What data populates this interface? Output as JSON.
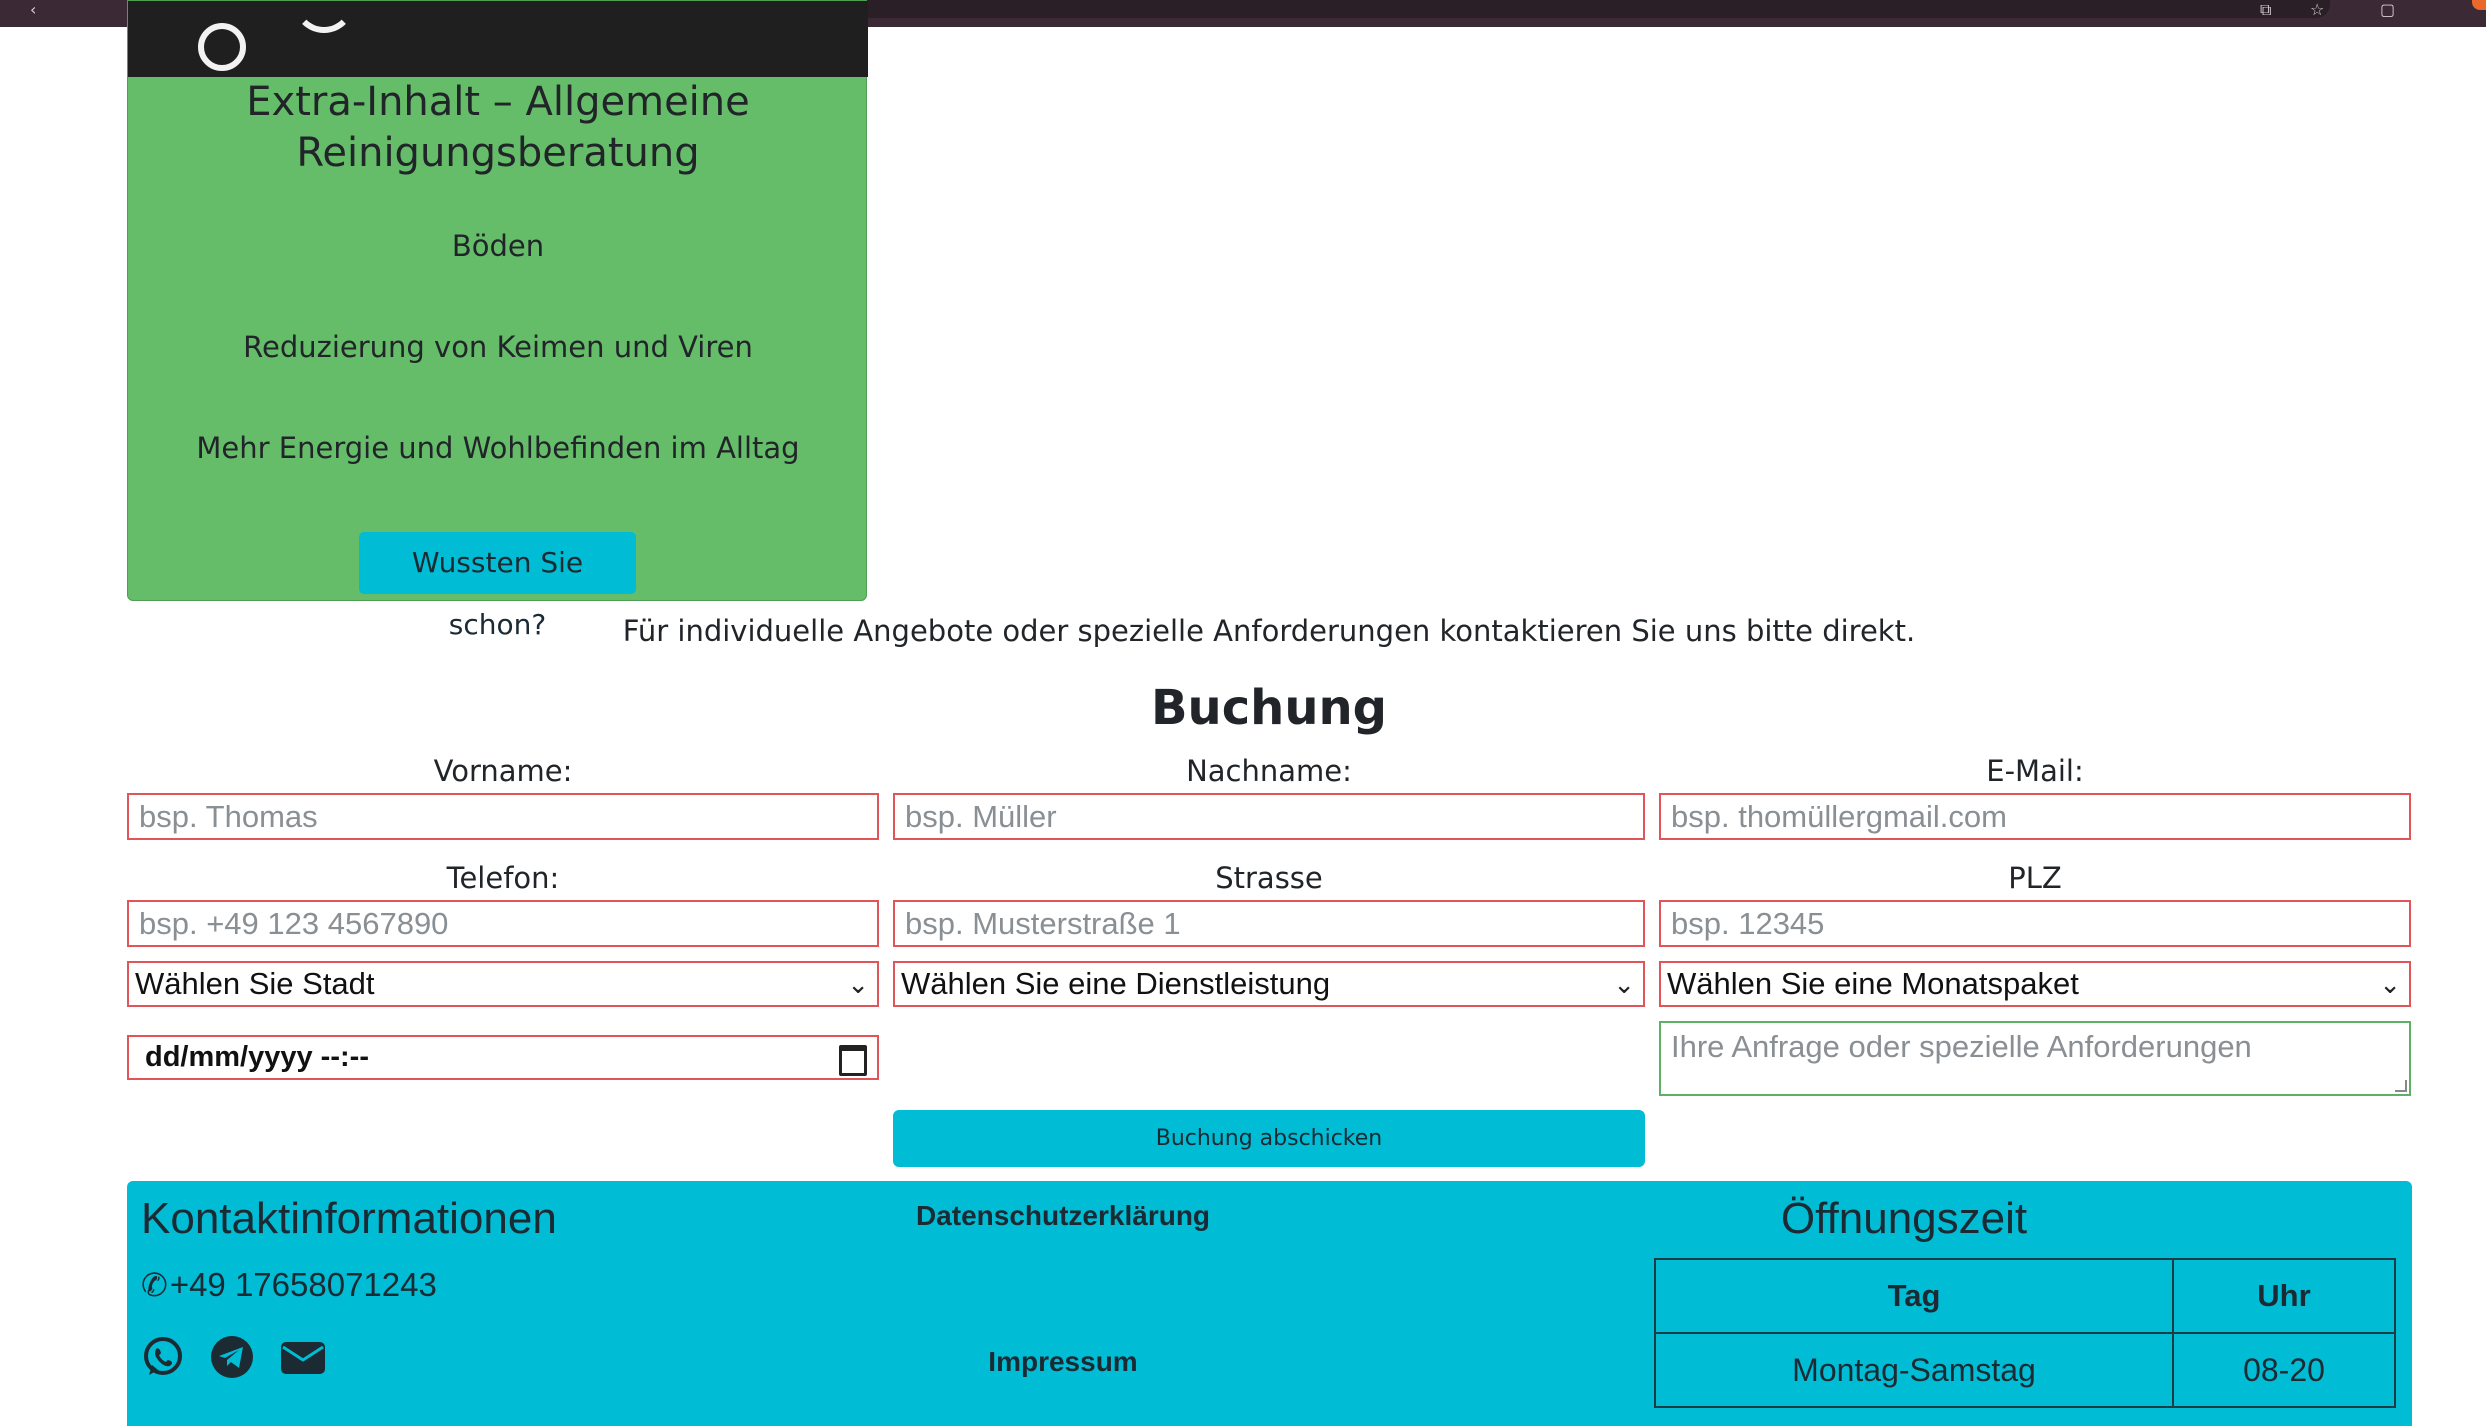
{
  "card": {
    "title_line1": "Extra-Inhalt – Allgemeine",
    "title_line2": "Reinigungsberatung",
    "items": [
      "Böden",
      "Reduzierung von Keimen und Viren",
      "Mehr Energie und Wohlbefinden im Alltag"
    ],
    "button_label": "Wussten Sie schon?",
    "colors": {
      "background": "#66bd69",
      "button": "#00bcd4"
    }
  },
  "contact_note": "Für individuelle Angebote oder spezielle Anforderungen kontaktieren Sie uns bitte direkt.",
  "booking": {
    "title": "Buchung",
    "fields": {
      "vorname": {
        "label": "Vorname:",
        "placeholder": "bsp. Thomas"
      },
      "nachname": {
        "label": "Nachname:",
        "placeholder": "bsp. Müller"
      },
      "email": {
        "label": "E-Mail:",
        "placeholder": "bsp. thomüllergmail.com"
      },
      "telefon": {
        "label": "Telefon:",
        "placeholder": "bsp. +49 123 4567890"
      },
      "strasse": {
        "label": "Strasse",
        "placeholder": "bsp. Musterstraße 1"
      },
      "plz": {
        "label": "PLZ",
        "placeholder": "bsp. 12345"
      }
    },
    "selects": {
      "stadt": "Wählen Sie Stadt",
      "dienstleistung": "Wählen Sie eine Dienstleistung",
      "monatspaket": "Wählen Sie eine Monatspaket"
    },
    "datetime_value": "dd/mm/yyyy --:--",
    "textarea_placeholder": "Ihre Anfrage oder spezielle Anforderungen",
    "submit_label": "Buchung abschicken"
  },
  "footer": {
    "contact_title": "Kontaktinformationen",
    "phone": "+49 17658071243",
    "social_icons": [
      "whatsapp-icon",
      "telegram-icon",
      "envelope-icon"
    ],
    "privacy_link": "Datenschutzerklärung",
    "imprint_link": "Impressum",
    "hours_title": "Öffnungszeit",
    "hours_table": {
      "headers": [
        "Tag",
        "Uhr"
      ],
      "rows": [
        [
          "Montag-Samstag",
          "08-20"
        ]
      ]
    },
    "colors": {
      "background": "#00bcd4"
    }
  }
}
